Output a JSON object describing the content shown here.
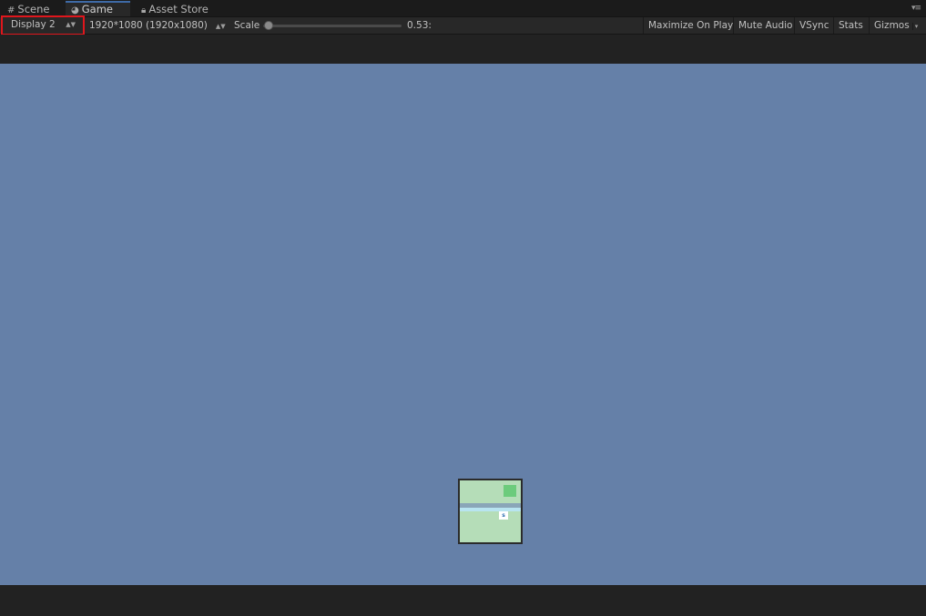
{
  "tabs": [
    {
      "label": "Scene",
      "icon": "grid-icon"
    },
    {
      "label": "Game",
      "icon": "pacman-icon",
      "active": true
    },
    {
      "label": "Asset Store",
      "icon": "lock-icon"
    }
  ],
  "tab_menu_icon": "panel-menu-icon",
  "toolbar": {
    "display_label": "Display 2",
    "resolution_label": "1920*1080 (1920x1080)",
    "scale_label": "Scale",
    "scale_value": "0.53:",
    "maximize_label": "Maximize On Play",
    "mute_label": "Mute Audio",
    "vsync_label": "VSync",
    "stats_label": "Stats",
    "gizmos_label": "Gizmos"
  },
  "game": {
    "player_label": "s",
    "background_color": "#6580a8"
  },
  "colors": {
    "highlight": "#e0161c",
    "active_tab_accent": "#3e6aa6"
  }
}
